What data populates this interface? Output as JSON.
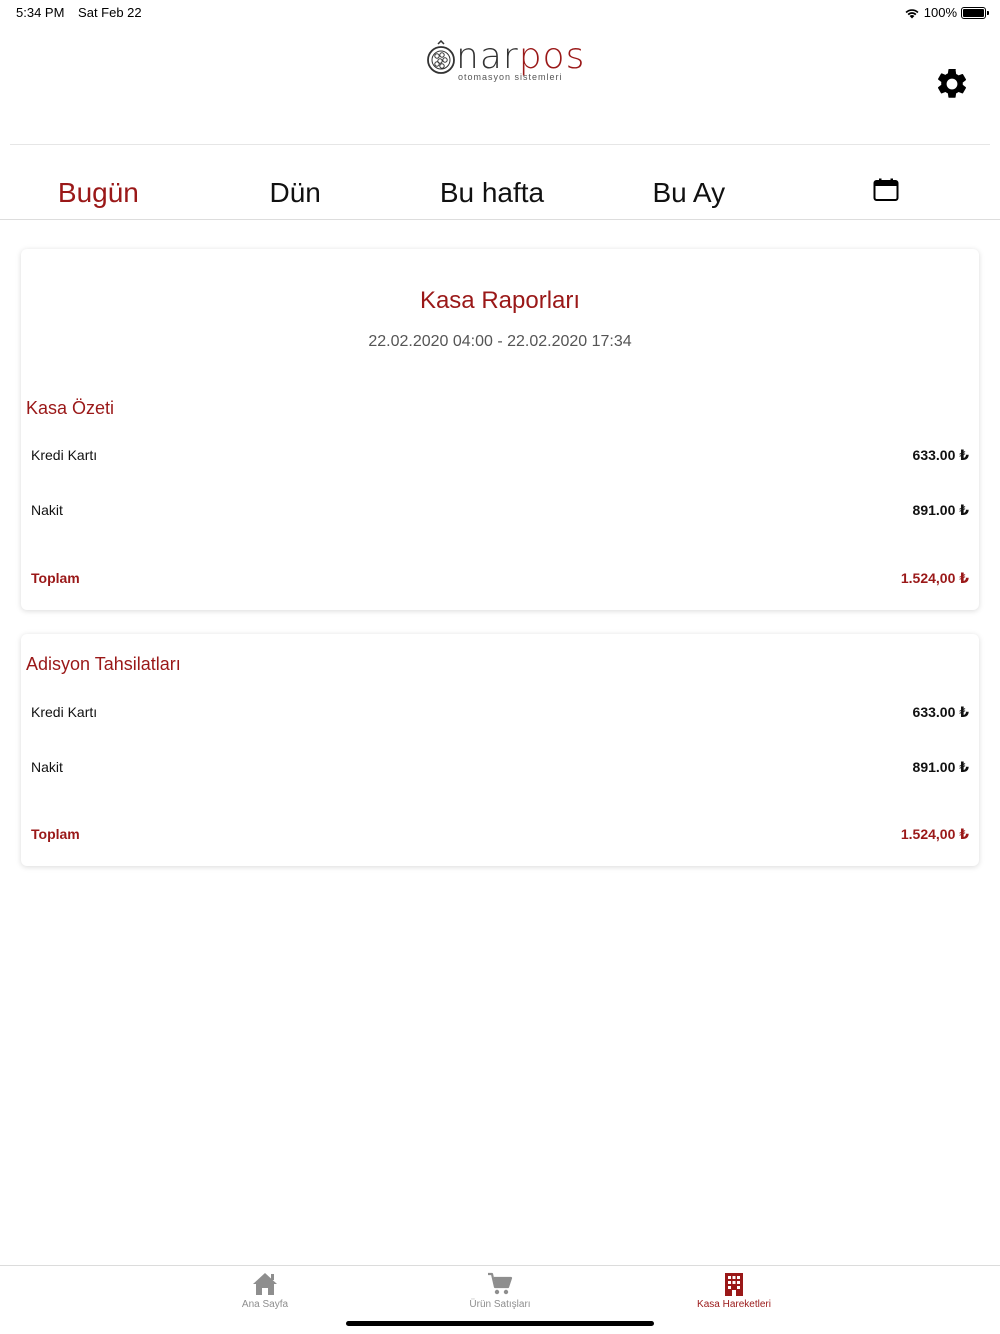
{
  "status_bar": {
    "time": "5:34 PM",
    "date": "Sat Feb 22",
    "battery": "100%"
  },
  "header": {
    "logo_main_dark": "nar",
    "logo_main_accent": "pos",
    "logo_sub": "otomasyon sistemleri",
    "settings_icon": "gear-icon"
  },
  "tabs": {
    "items": [
      {
        "label": "Bugün",
        "active": true
      },
      {
        "label": "Dün",
        "active": false
      },
      {
        "label": "Bu hafta",
        "active": false
      },
      {
        "label": "Bu Ay",
        "active": false
      }
    ],
    "calendar_icon": "calendar-icon"
  },
  "report": {
    "title": "Kasa Raporları",
    "range": "22.02.2020 04:00 - 22.02.2020 17:34"
  },
  "kasa_ozeti": {
    "title": "Kasa Özeti",
    "rows": [
      {
        "label": "Kredi Kartı",
        "value": "633.00 ₺"
      },
      {
        "label": "Nakit",
        "value": "891.00 ₺"
      }
    ],
    "total": {
      "label": "Toplam",
      "value": "1.524,00 ₺"
    }
  },
  "adisyon": {
    "title": "Adisyon Tahsilatları",
    "rows": [
      {
        "label": "Kredi Kartı",
        "value": "633.00 ₺"
      },
      {
        "label": "Nakit",
        "value": "891.00 ₺"
      }
    ],
    "total": {
      "label": "Toplam",
      "value": "1.524,00 ₺"
    }
  },
  "tabbar": {
    "items": [
      {
        "label": "Ana Sayfa",
        "icon": "home-icon",
        "active": false
      },
      {
        "label": "Ürün Satışları",
        "icon": "cart-icon",
        "active": false
      },
      {
        "label": "Kasa Hareketleri",
        "icon": "building-icon",
        "active": true
      }
    ]
  },
  "colors": {
    "accent": "#9a1818",
    "inactive": "#8e8e8e"
  }
}
